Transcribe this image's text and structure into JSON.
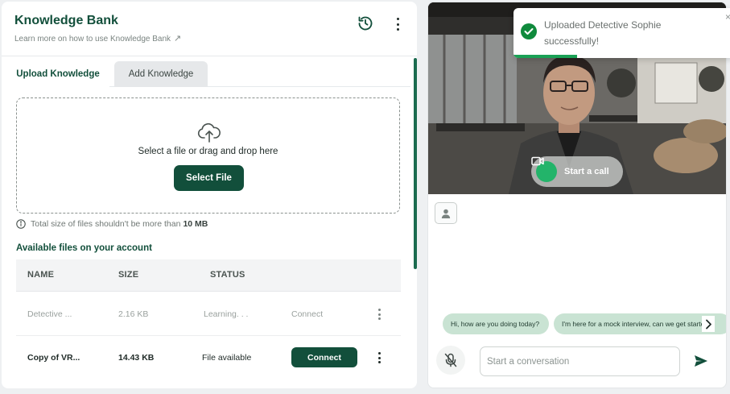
{
  "knowledge_bank": {
    "title": "Knowledge Bank",
    "help_link": "Learn more on how to use Knowledge Bank",
    "help_link_arrow": "↗"
  },
  "tabs": {
    "upload": "Upload Knowledge",
    "add": "Add Knowledge"
  },
  "dropzone": {
    "text": "Select a file or drag and drop here",
    "button": "Select File"
  },
  "size_note": {
    "text": "Total size of files shouldn't be more than",
    "limit": "10 MB"
  },
  "files": {
    "title": "Available files on your account",
    "columns": [
      "NAME",
      "SIZE",
      "STATUS"
    ],
    "rows": [
      {
        "name": "Detective ...",
        "size": "2.16 KB",
        "status": "Learning. . .",
        "action": "Connect"
      },
      {
        "name": "Copy of VR...",
        "size": "14.43 KB",
        "status": "File available",
        "action": "Connect"
      }
    ]
  },
  "video": {
    "call_button": "Start a call"
  },
  "chat": {
    "suggestions": [
      "Hi, how are you doing today?",
      "I'm here for a mock interview, can we get started"
    ],
    "input_placeholder": "Start a conversation",
    "input_value": ""
  },
  "toast": {
    "message": "Uploaded Detective Sophie successfully!",
    "close": "×",
    "progress": 0.29
  },
  "colors": {
    "brand": "#124f3b",
    "accent_green": "#23b46a",
    "chip_bg": "#c9e3d3"
  }
}
